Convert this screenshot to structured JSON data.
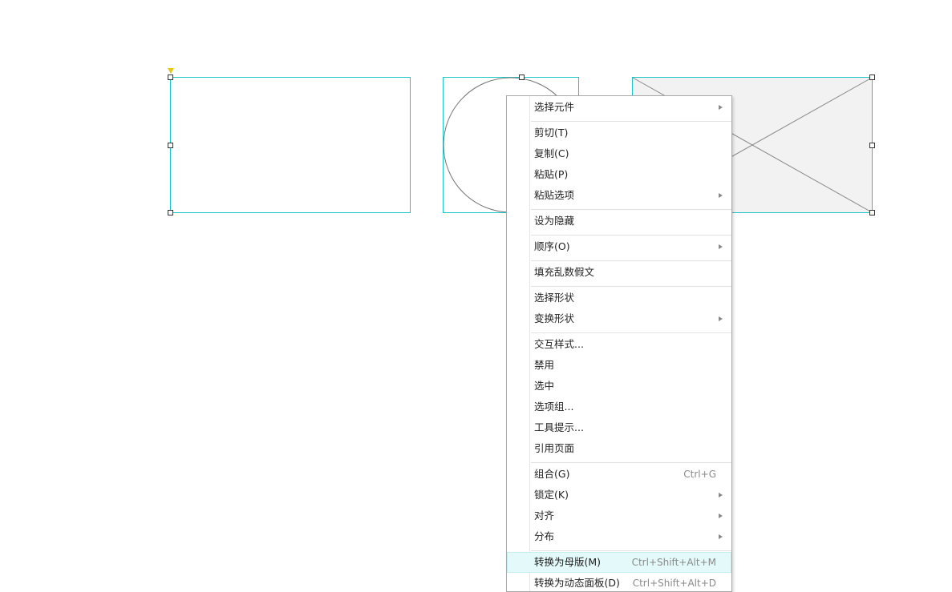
{
  "canvas": {
    "shapes": [
      {
        "kind": "rectangle",
        "icon": "selection-handle-icon"
      },
      {
        "kind": "ellipse",
        "icon": "selection-handle-icon"
      },
      {
        "kind": "image-placeholder",
        "icon": "selection-handle-icon"
      }
    ],
    "colors": {
      "selection_border": "#1fc4c4",
      "anchor": "#e6c619",
      "placeholder_fill": "#f2f2f2",
      "menu_highlight": "#e4f9f9"
    }
  },
  "context_menu": {
    "items": [
      {
        "label": "选择元件",
        "shortcut": "",
        "submenu": true
      },
      {
        "label": "剪切(T)",
        "shortcut": "",
        "submenu": false
      },
      {
        "label": "复制(C)",
        "shortcut": "",
        "submenu": false
      },
      {
        "label": "粘贴(P)",
        "shortcut": "",
        "submenu": false
      },
      {
        "label": "粘贴选项",
        "shortcut": "",
        "submenu": true
      },
      {
        "label": "设为隐藏",
        "shortcut": "",
        "submenu": false
      },
      {
        "label": "顺序(O)",
        "shortcut": "",
        "submenu": true
      },
      {
        "label": "填充乱数假文",
        "shortcut": "",
        "submenu": false
      },
      {
        "label": "选择形状",
        "shortcut": "",
        "submenu": false
      },
      {
        "label": "变换形状",
        "shortcut": "",
        "submenu": true
      },
      {
        "label": "交互样式...",
        "shortcut": "",
        "submenu": false
      },
      {
        "label": "禁用",
        "shortcut": "",
        "submenu": false
      },
      {
        "label": "选中",
        "shortcut": "",
        "submenu": false
      },
      {
        "label": "选项组...",
        "shortcut": "",
        "submenu": false
      },
      {
        "label": "工具提示...",
        "shortcut": "",
        "submenu": false
      },
      {
        "label": "引用页面",
        "shortcut": "",
        "submenu": false
      },
      {
        "label": "组合(G)",
        "shortcut": "Ctrl+G",
        "submenu": false
      },
      {
        "label": "锁定(K)",
        "shortcut": "",
        "submenu": true
      },
      {
        "label": "对齐",
        "shortcut": "",
        "submenu": true
      },
      {
        "label": "分布",
        "shortcut": "",
        "submenu": true
      },
      {
        "label": "转换为母版(M)",
        "shortcut": "Ctrl+Shift+Alt+M",
        "submenu": false
      },
      {
        "label": "转换为动态面板(D)",
        "shortcut": "Ctrl+Shift+Alt+D",
        "submenu": false
      }
    ]
  }
}
